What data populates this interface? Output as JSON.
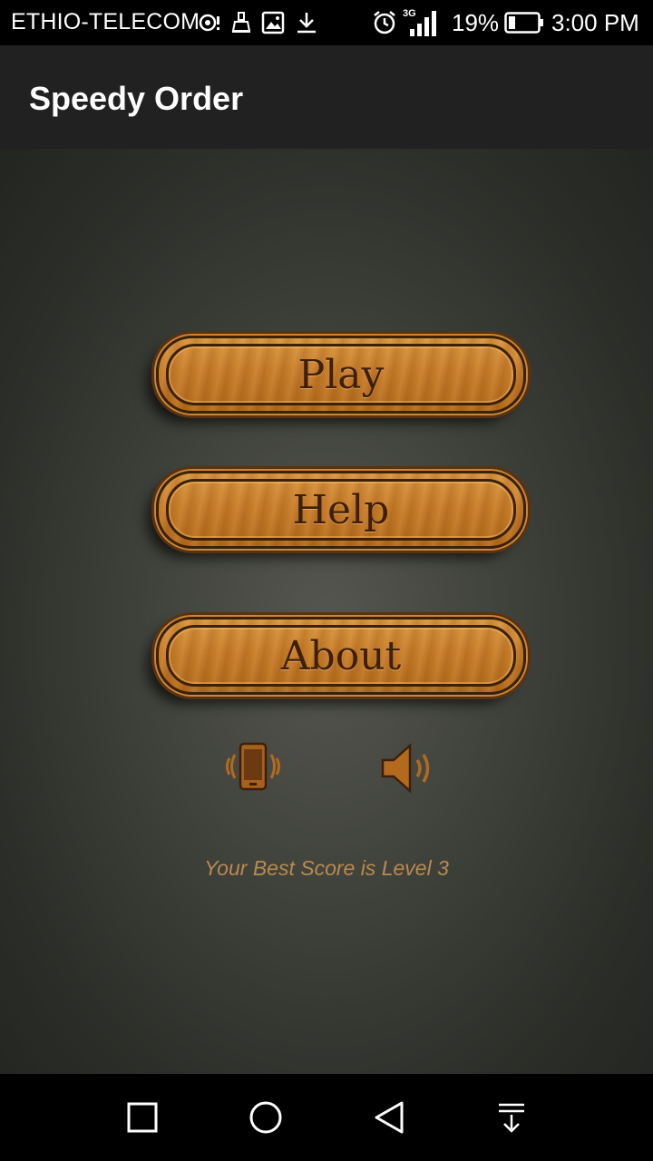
{
  "status_bar": {
    "carrier": "ETHIO-TELECOM",
    "network_type": "3G",
    "battery_percent": "19%",
    "time": "3:00 PM",
    "icons": [
      "notification-icon",
      "cleaner-icon",
      "image-icon",
      "download-icon",
      "alarm-icon",
      "signal-icon",
      "battery-icon"
    ]
  },
  "app_bar": {
    "title": "Speedy Order"
  },
  "menu": {
    "play_label": "Play",
    "help_label": "Help",
    "about_label": "About"
  },
  "toggles": {
    "vibration_icon": "vibration-icon",
    "sound_icon": "speaker-icon"
  },
  "best_score_text": "Your Best Score is Level 3",
  "nav_bar": {
    "icons": [
      "recent-apps-icon",
      "home-icon",
      "back-icon",
      "notification-pulldown-icon"
    ]
  },
  "colors": {
    "app_bar": "#212121",
    "wood": "#c77d2a",
    "wood_text": "#3e1f08",
    "score_text": "#b98a4e"
  }
}
